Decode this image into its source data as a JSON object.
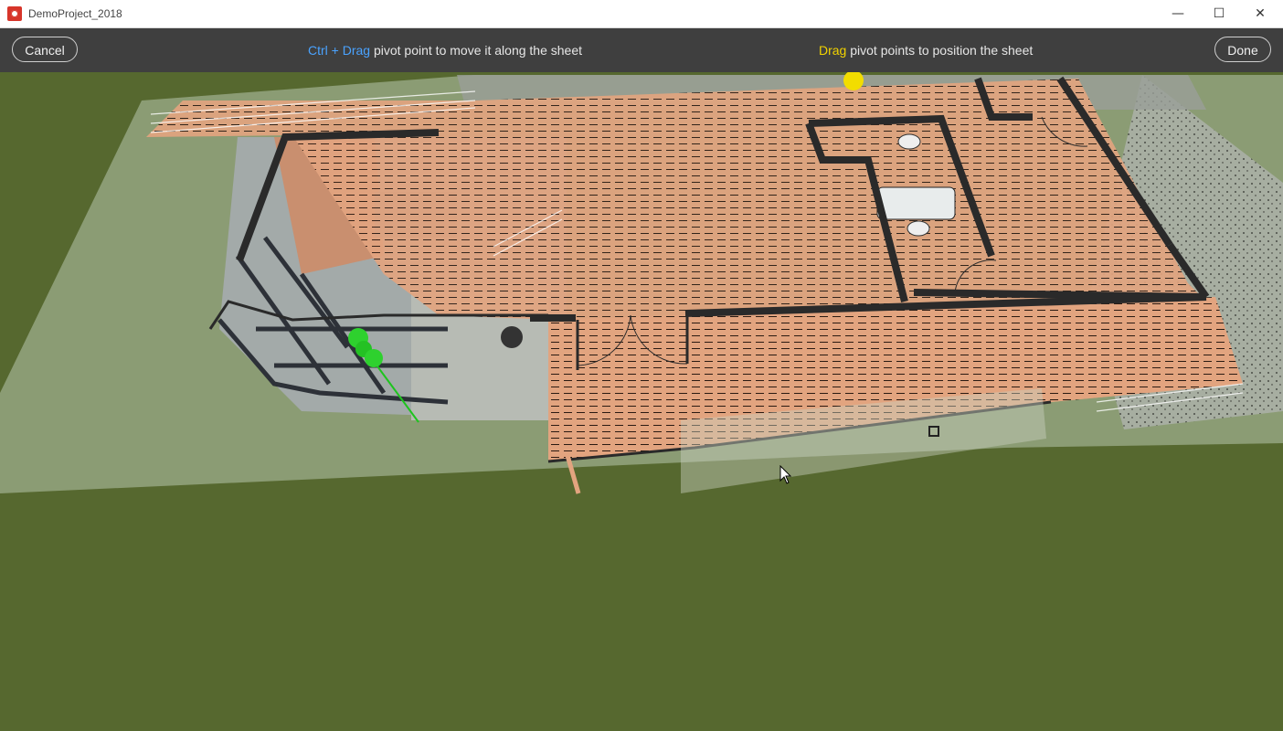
{
  "window": {
    "title": "DemoProject_2018",
    "controls": {
      "minimize": "—",
      "maximize": "☐",
      "close": "✕"
    }
  },
  "toolbar": {
    "cancel_label": "Cancel",
    "done_label": "Done",
    "hint_left": {
      "key": "Ctrl + Drag",
      "text": " pivot point to move it along the sheet"
    },
    "hint_right": {
      "key": "Drag",
      "text": " pivot points to position the sheet"
    }
  },
  "colors": {
    "toolbar_bg": "#3f3f3f",
    "accent_blue": "#4aa3ff",
    "accent_yellow": "#f2d300",
    "ground": "#56682f",
    "floor_sheet": "#e3a47e",
    "pivot_green": "#2ed12e",
    "pivot_yellow": "#f2dd00"
  },
  "viewport": {
    "content": "3D model view with floor plan sheet overlay",
    "icons": [
      "pivot-point-green-icon",
      "pivot-point-yellow-icon",
      "mouse-cursor-icon"
    ]
  }
}
